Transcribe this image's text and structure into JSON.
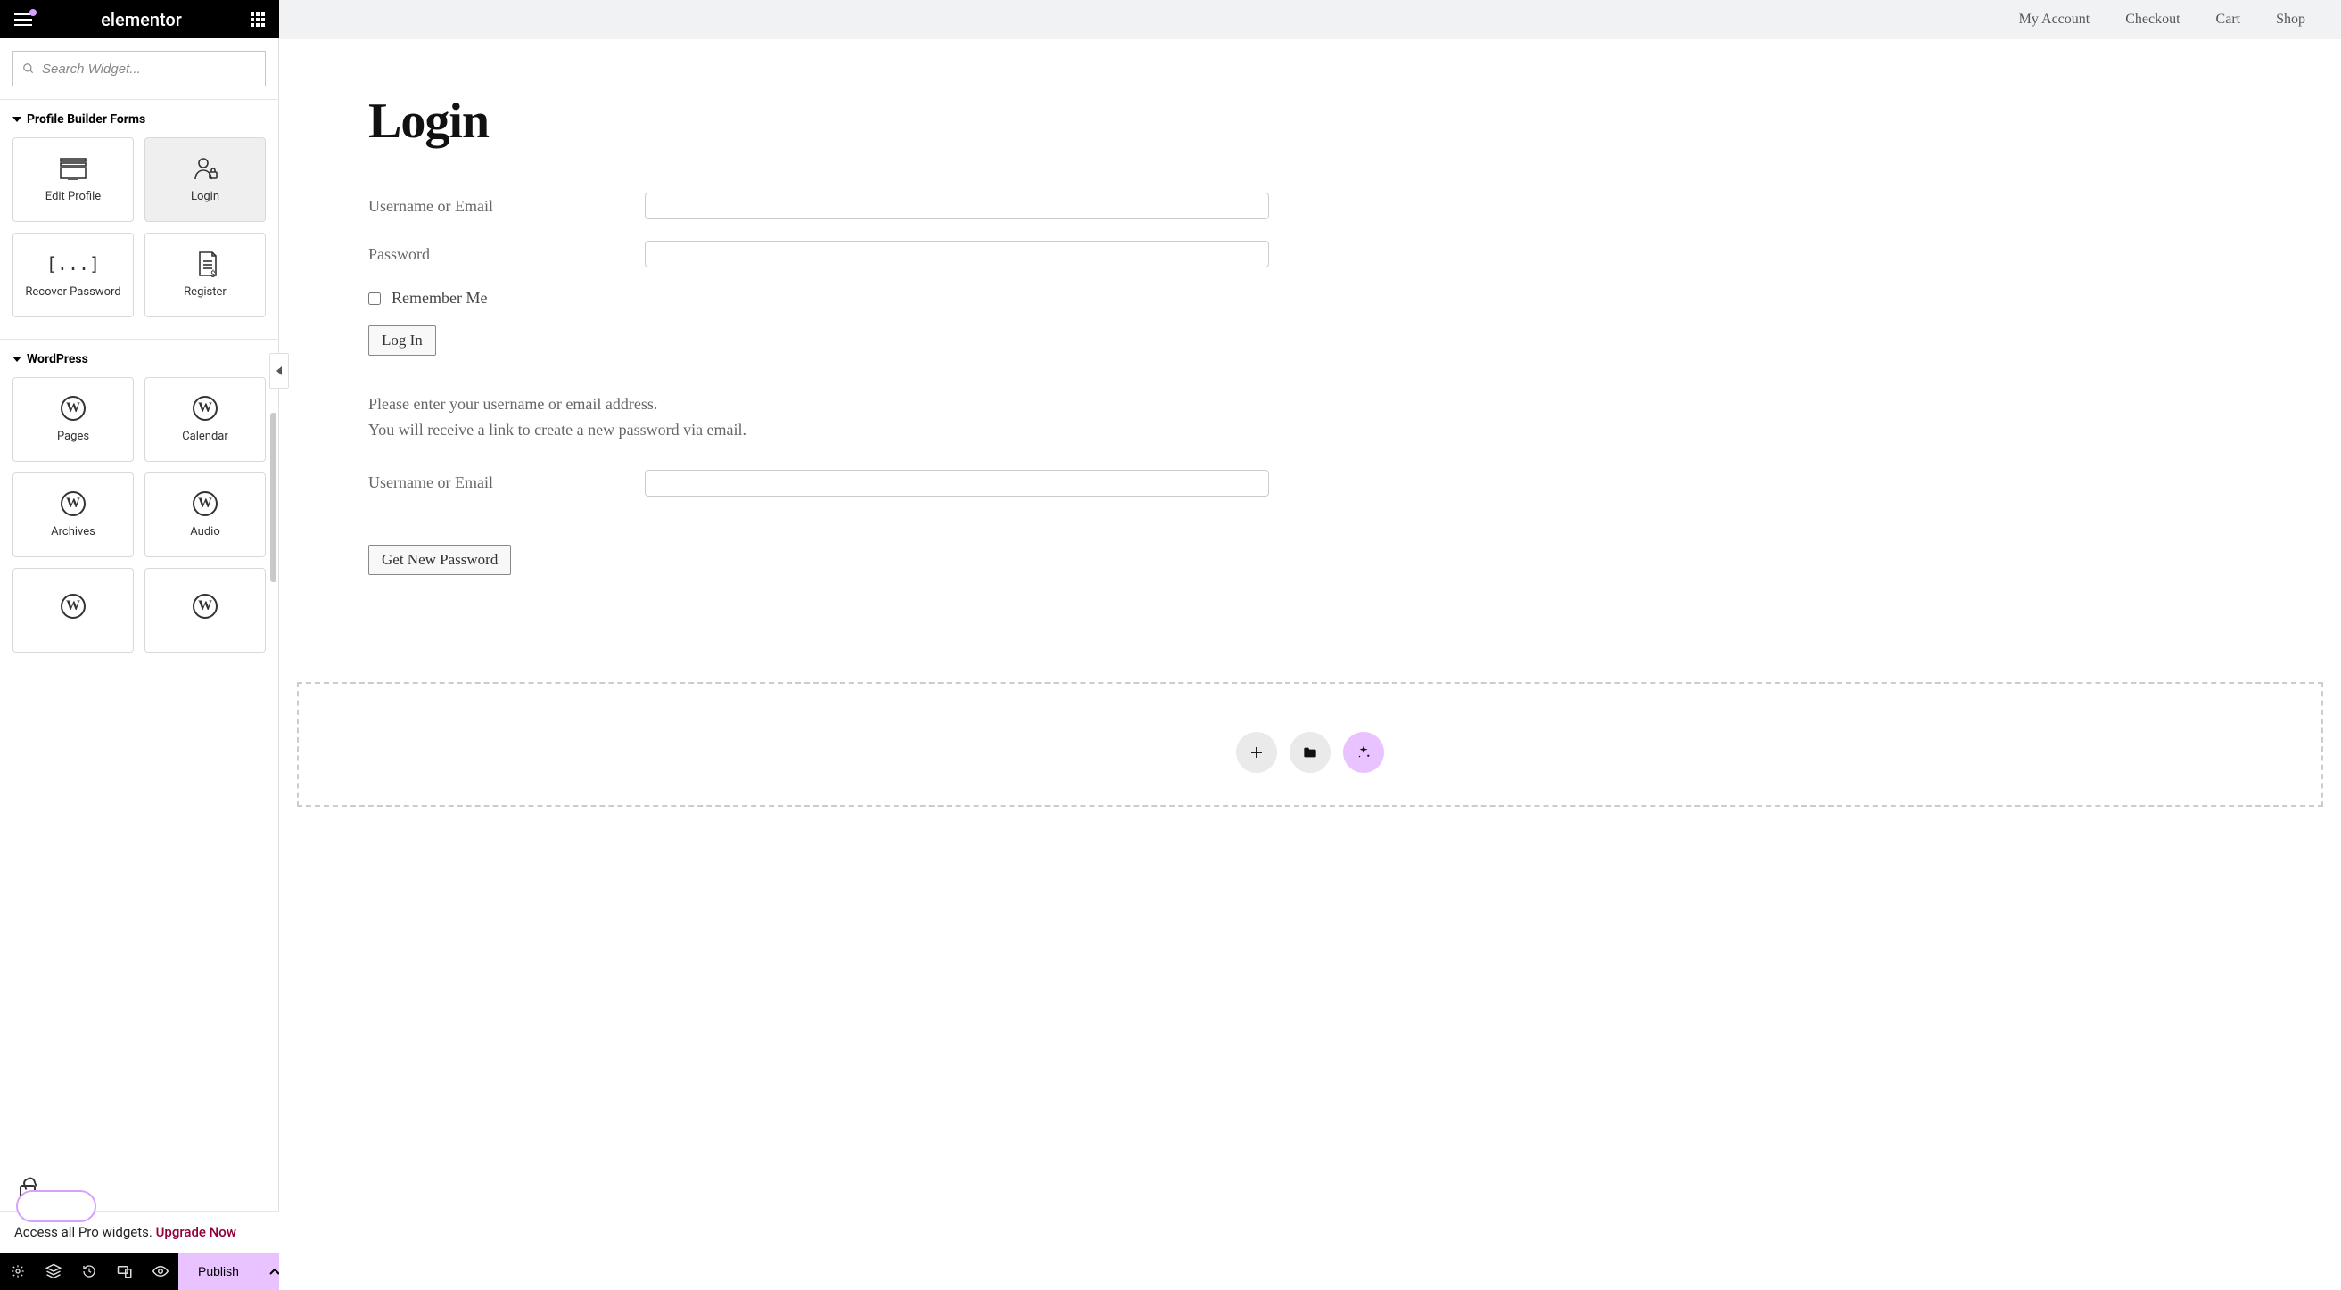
{
  "brand": "elementor",
  "search": {
    "placeholder": "Search Widget..."
  },
  "sections": {
    "profile_builder_title": "Profile Builder Forms",
    "wordpress_title": "WordPress"
  },
  "widgets": {
    "profile_builder": [
      {
        "label": "Edit Profile"
      },
      {
        "label": "Login"
      },
      {
        "label": "Recover Password"
      },
      {
        "label": "Register"
      }
    ],
    "wordpress": [
      {
        "label": "Pages"
      },
      {
        "label": "Calendar"
      },
      {
        "label": "Archives"
      },
      {
        "label": "Audio"
      }
    ]
  },
  "upgrade": {
    "text": "Access all Pro widgets. ",
    "link": "Upgrade Now"
  },
  "footer": {
    "publish": "Publish"
  },
  "preview": {
    "nav": {
      "my_account": "My Account",
      "checkout": "Checkout",
      "cart": "Cart",
      "shop": "Shop"
    },
    "page_title": "Login",
    "login_form": {
      "username_label": "Username or Email",
      "password_label": "Password",
      "remember_label": "Remember Me",
      "submit_label": "Log In"
    },
    "recover": {
      "info_line1": "Please enter your username or email address.",
      "info_line2": "You will receive a link to create a new password via email.",
      "username_label": "Username or Email",
      "submit_label": "Get New Password"
    }
  }
}
